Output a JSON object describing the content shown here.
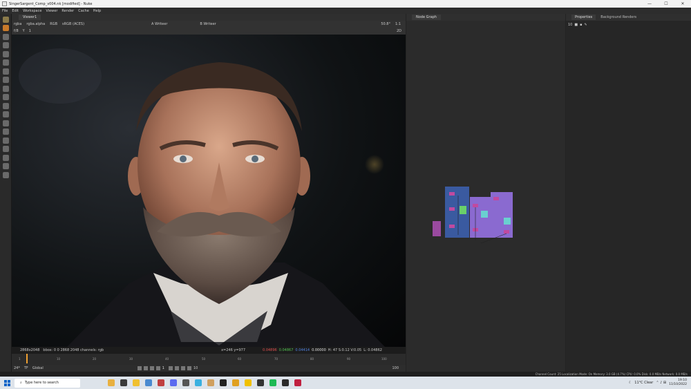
{
  "window": {
    "title": "SingerSargent_Comp_v004.nk [modified] - Nuke",
    "min": "—",
    "max": "☐",
    "close": "✕"
  },
  "menu": [
    "File",
    "Edit",
    "Workspace",
    "Viewer",
    "Render",
    "Cache",
    "Help"
  ],
  "viewer": {
    "tab_label": "Viewer1",
    "channels": "rgba",
    "alpha": "rgba.alpha",
    "display": "RGB",
    "colorspace": "sRGB (ACES)",
    "input_a": "A  Writeer",
    "input_b": "B  Writeer",
    "zoom": "50.8°",
    "ratio": "1:1",
    "frame_prefix": "f/8",
    "y_label": "Y",
    "y_value": "1",
    "mode": "2D"
  },
  "info": {
    "resolution": "2868x2048",
    "bbox": "bbox: 0 0 2868 2048 channels: rgb",
    "coords": "x=246 y=977",
    "r": "0.04896",
    "g": "0.04867",
    "b": "0.04414",
    "a": "0.00000",
    "hsv": "H: 47 S:0.12 V:0.05",
    "lum": "L: 0.04862"
  },
  "timeline": {
    "ticks": [
      "1",
      "10",
      "20",
      "30",
      "40",
      "50",
      "60",
      "70",
      "80",
      "90",
      "100"
    ],
    "current_frame": "1",
    "fps": "24*",
    "tf": "TF",
    "range": "Global",
    "end_frame": "100",
    "step": "10"
  },
  "nodegraph": {
    "tab_label": "Node Graph"
  },
  "properties": {
    "tab_label": "Properties",
    "tab2_label": "Background Renders",
    "count": "10"
  },
  "status": "Channel Count: 25  Localization Mode: On  Memory: 3.0 GB (4.7%)  CPU: 0.0%  Disk: 0.0 MB/s  Network: 0.0 MB/s",
  "taskbar": {
    "search_placeholder": "Type here to search",
    "weather": "11°C  Clear",
    "time": "19:10",
    "date": "11/10/2022"
  }
}
